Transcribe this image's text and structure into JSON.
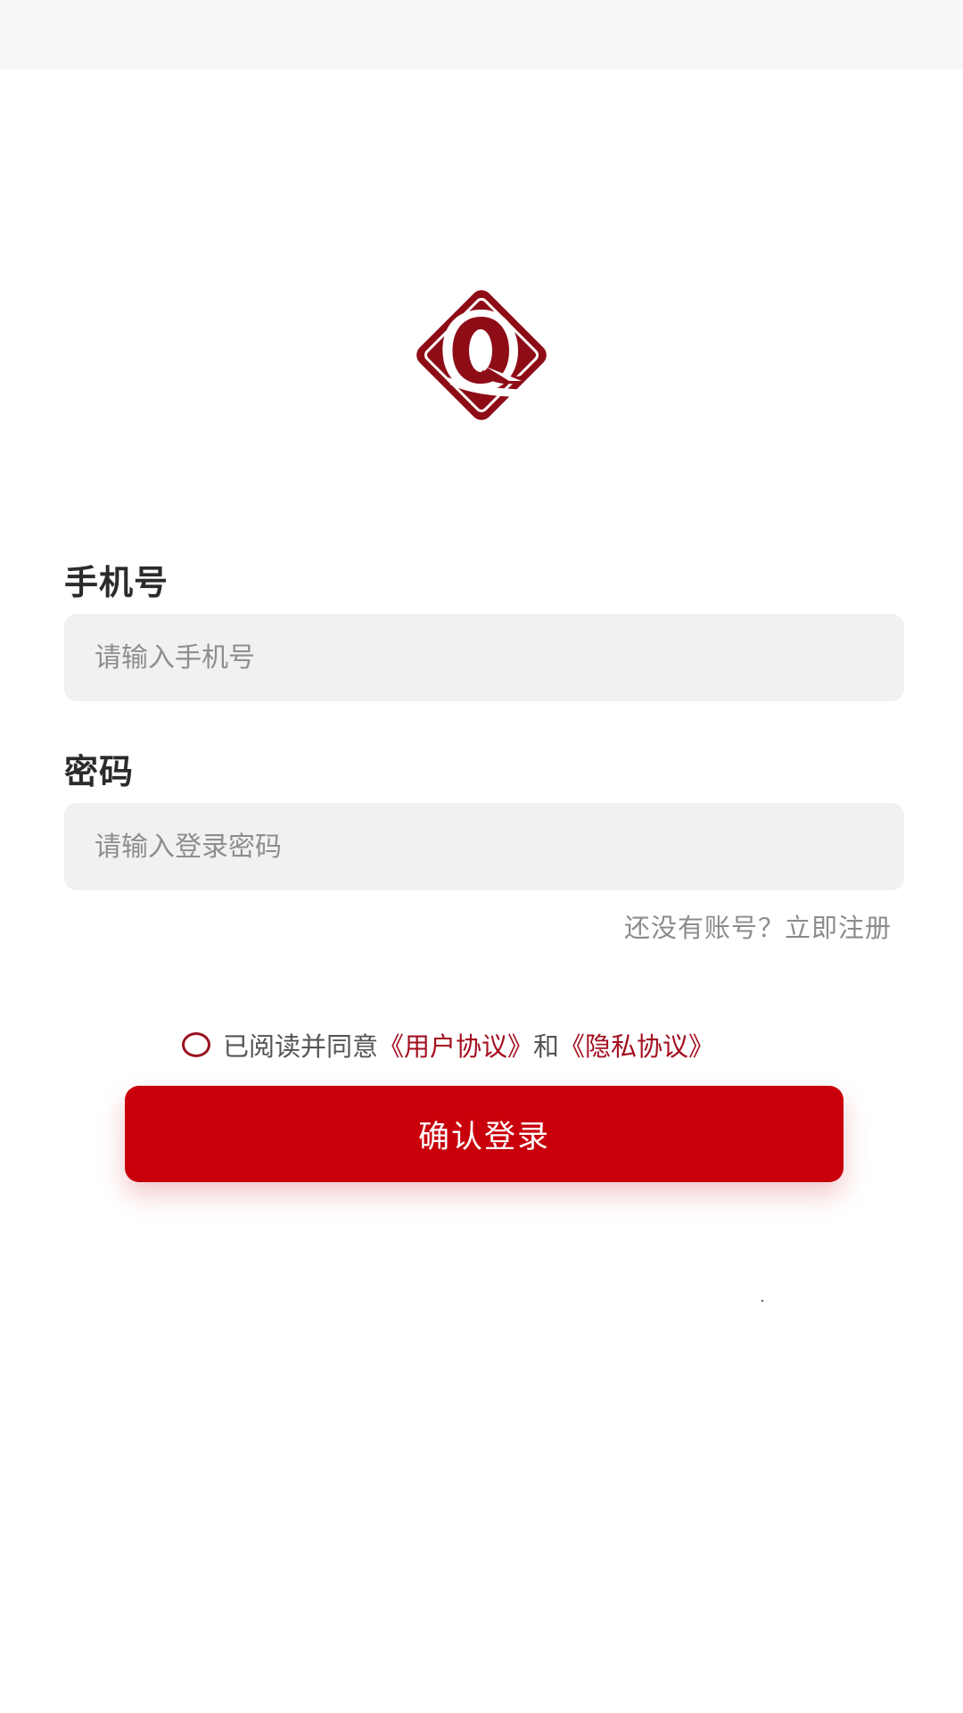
{
  "status_bar": {},
  "logo": {
    "icon": "q-diamond-logo-icon",
    "brand_color": "#8e0c16"
  },
  "phone": {
    "label": "手机号",
    "placeholder": "请输入手机号"
  },
  "password": {
    "label": "密码",
    "placeholder": "请输入登录密码"
  },
  "register_link": "还没有账号？立即注册",
  "agreement": {
    "prefix": "已阅读并同意",
    "user_agreement": "《用户协议》",
    "and": "和",
    "privacy_policy": "《隐私协议》",
    "checked": false
  },
  "login_button": "确认登录",
  "colors": {
    "primary": "#c9000b",
    "link": "#a30f1f",
    "input_bg": "#f1f1f1"
  }
}
